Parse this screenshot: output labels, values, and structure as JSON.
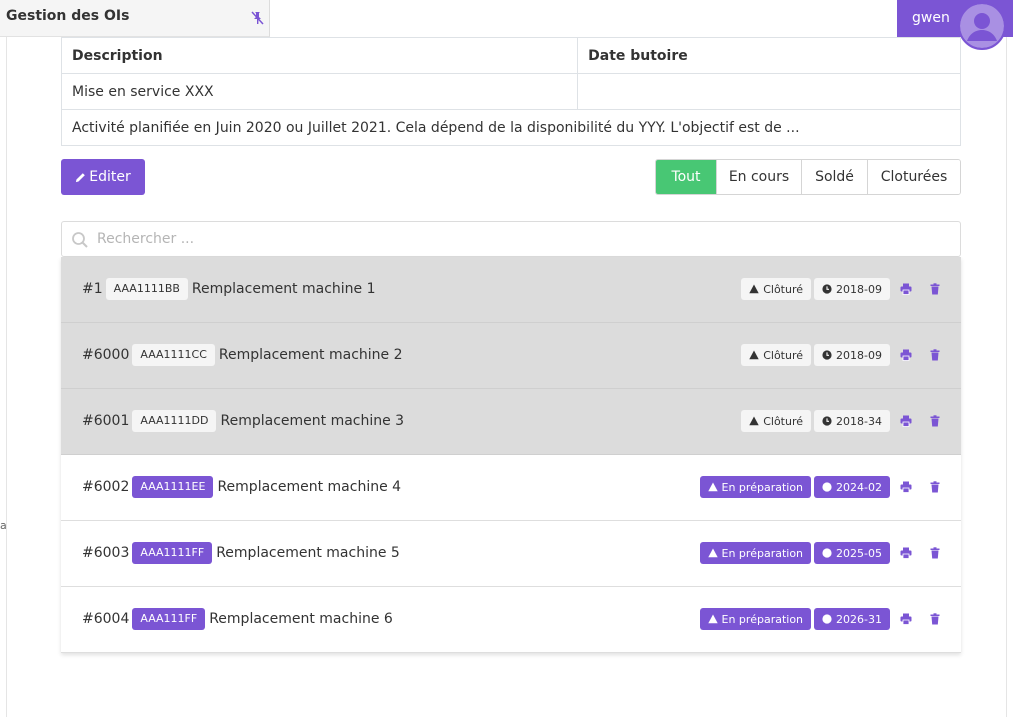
{
  "app": {
    "title": "Gestion des OIs"
  },
  "user": {
    "name": "gwen"
  },
  "edge_text": "a",
  "table": {
    "headers": [
      "Description",
      "Date butoire"
    ],
    "row": {
      "description": "Mise en service XXX",
      "date": ""
    },
    "note": "Activité planifiée en Juin 2020 ou Juillet 2021. Cela dépend de la disponibilité du YYY. L'objectif est de ..."
  },
  "toolbar": {
    "edit_label": "Editer"
  },
  "filters": [
    {
      "label": "Tout",
      "active": true
    },
    {
      "label": "En cours",
      "active": false
    },
    {
      "label": "Soldé",
      "active": false
    },
    {
      "label": "Cloturées",
      "active": false
    }
  ],
  "search": {
    "placeholder": "Rechercher ...",
    "value": ""
  },
  "items": [
    {
      "num": "#1",
      "code": "AAA1111BB",
      "title": "Remplacement machine 1",
      "status": "Clôturé",
      "date": "2018-09",
      "closed": true
    },
    {
      "num": "#6000",
      "code": "AAA1111CC",
      "title": "Remplacement machine 2",
      "status": "Clôturé",
      "date": "2018-09",
      "closed": true
    },
    {
      "num": "#6001",
      "code": "AAA1111DD",
      "title": "Remplacement machine 3",
      "status": "Clôturé",
      "date": "2018-34",
      "closed": true
    },
    {
      "num": "#6002",
      "code": "AAA1111EE",
      "title": "Remplacement machine 4",
      "status": "En préparation",
      "date": "2024-02",
      "closed": false
    },
    {
      "num": "#6003",
      "code": "AAA1111FF",
      "title": "Remplacement machine 5",
      "status": "En préparation",
      "date": "2025-05",
      "closed": false
    },
    {
      "num": "#6004",
      "code": "AAA111FF",
      "title": "Remplacement machine 6",
      "status": "En préparation",
      "date": "2026-31",
      "closed": false
    }
  ],
  "colors": {
    "accent": "#7b55d4",
    "active_filter": "#48c774",
    "closed_row": "#dcdcdc"
  },
  "icons": {
    "pin": "pin-off-icon",
    "status": "warning-icon",
    "date": "clock-icon",
    "print": "print-icon",
    "delete": "trash-icon",
    "edit": "pencil-icon",
    "search": "search-icon"
  }
}
